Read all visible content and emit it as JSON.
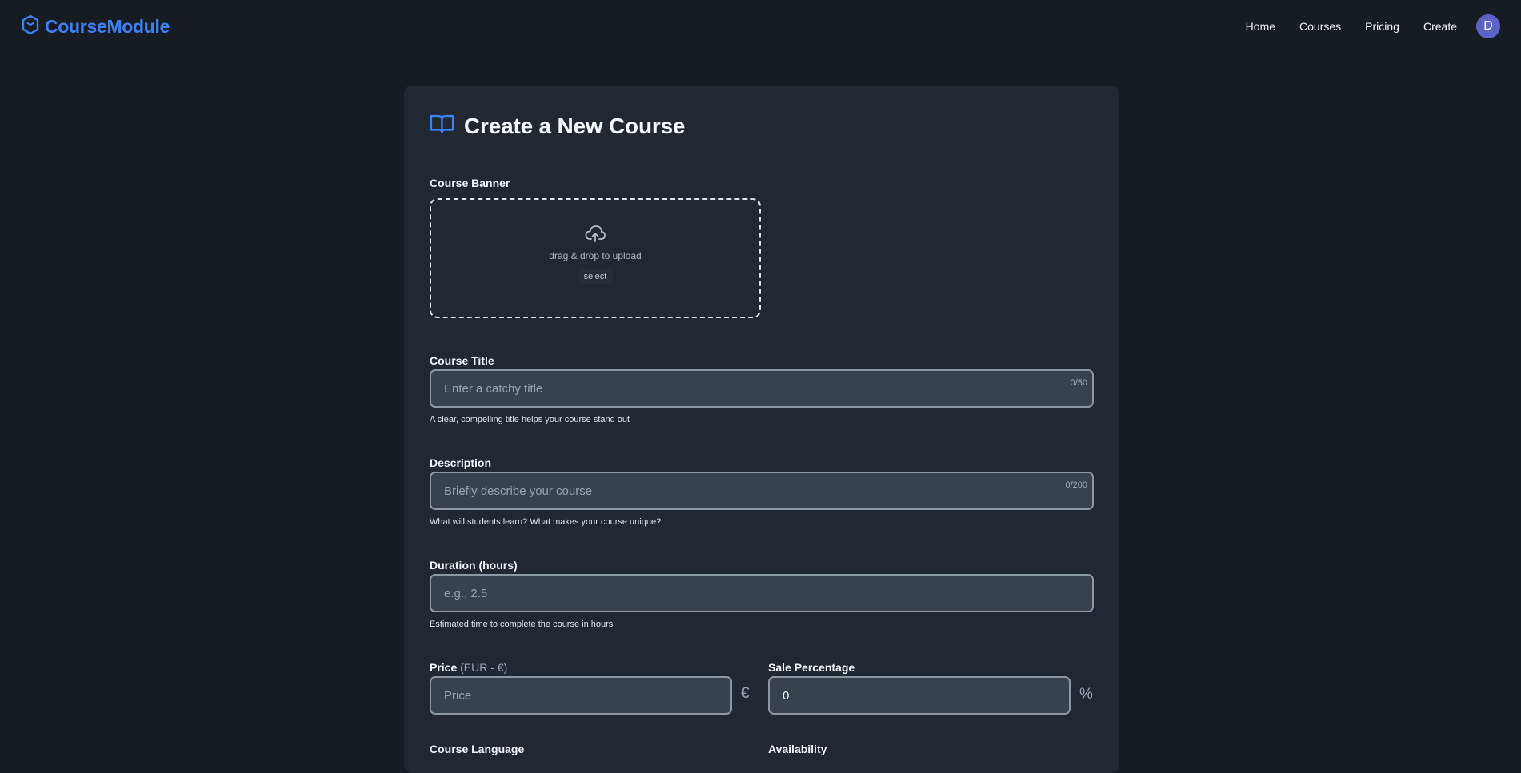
{
  "app": {
    "brand": "CourseModule",
    "nav": [
      "Home",
      "Courses",
      "Pricing",
      "Create"
    ],
    "avatar_initial": "D",
    "accent_color": "#3b82f6"
  },
  "form": {
    "heading": "Create a New Course",
    "banner": {
      "label": "Course Banner",
      "drop_text": "drag & drop to upload",
      "select_label": "select"
    },
    "title": {
      "label": "Course Title",
      "placeholder": "Enter a catchy title",
      "counter": "0/50",
      "hint": "A clear, compelling title helps your course stand out"
    },
    "description": {
      "label": "Description",
      "placeholder": "Briefly describe your course",
      "counter": "0/200",
      "hint": "What will students learn? What makes your course unique?"
    },
    "duration": {
      "label": "Duration (hours)",
      "placeholder": "e.g., 2.5",
      "hint": "Estimated time to complete the course in hours"
    },
    "price": {
      "label": "Price",
      "label_sub": "(EUR - €)",
      "placeholder": "Price",
      "currency_symbol": "€"
    },
    "sale": {
      "label": "Sale Percentage",
      "value": "0",
      "percent_symbol": "%"
    },
    "language": {
      "label": "Course Language"
    },
    "availability": {
      "label": "Availability"
    }
  }
}
